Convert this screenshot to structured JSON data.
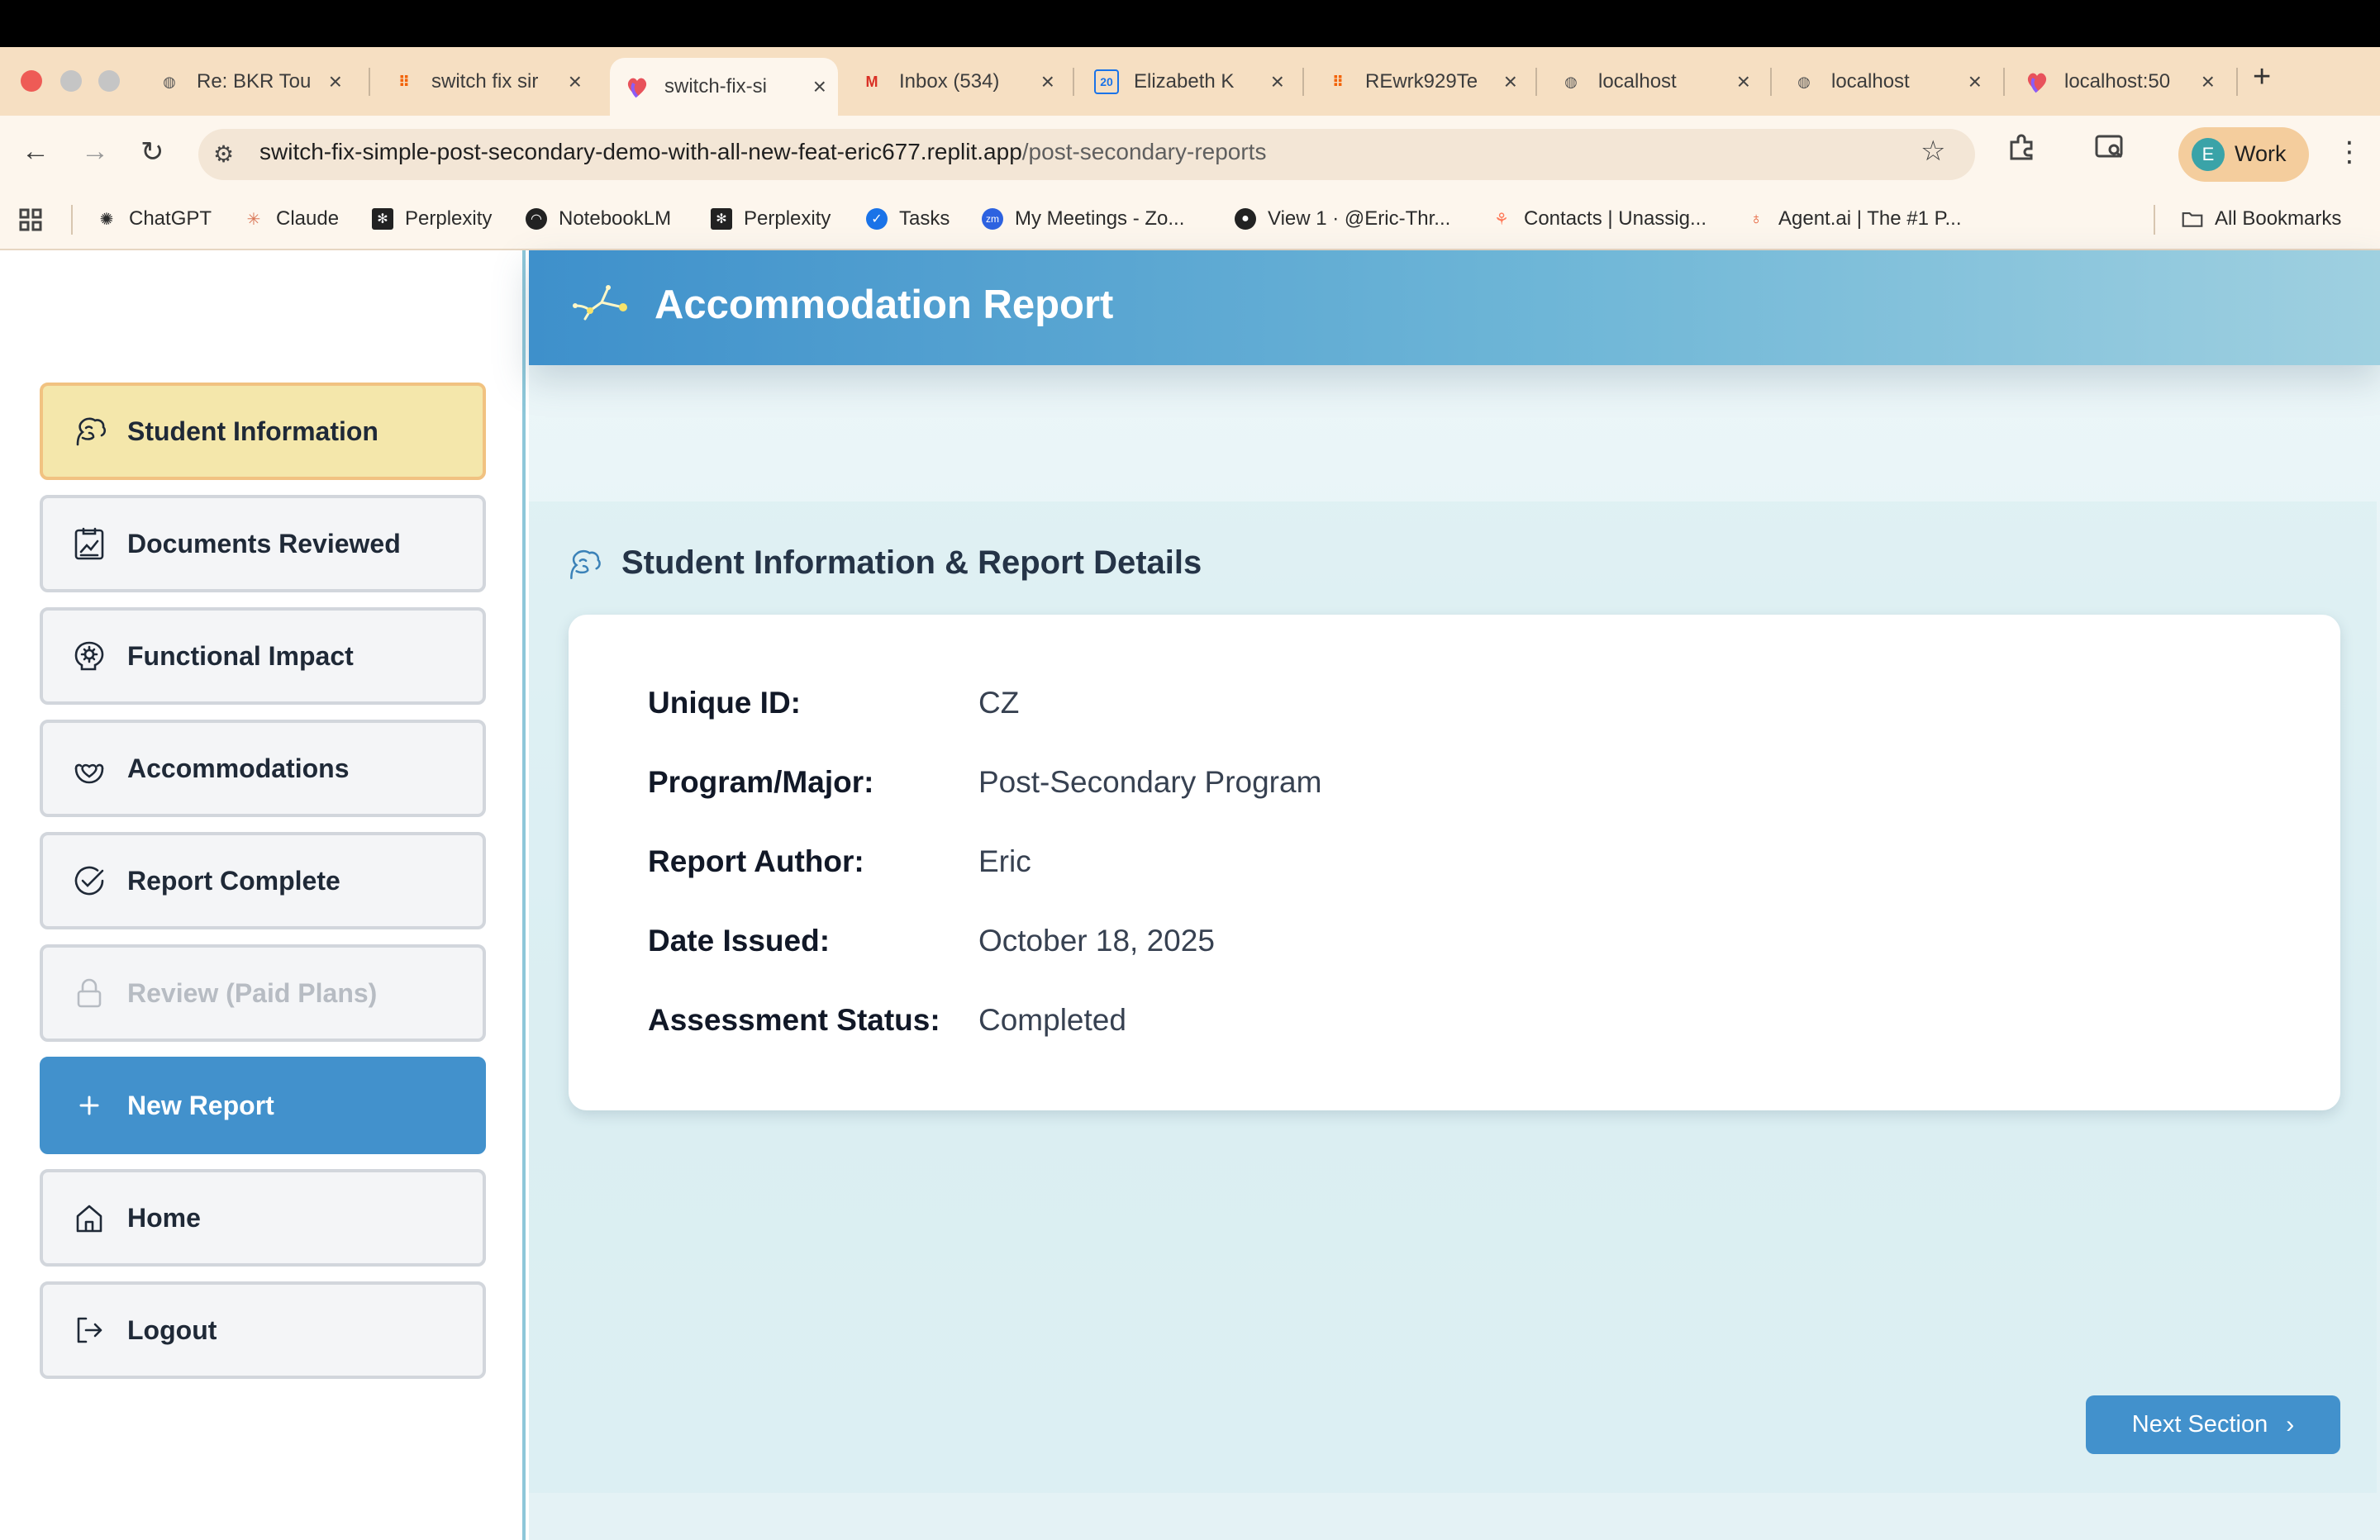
{
  "browser": {
    "tabs": [
      {
        "title": "Re: BKR Tou",
        "icon": "globe-icon"
      },
      {
        "title": "switch fix sir",
        "icon": "replit-icon"
      },
      {
        "title": "switch-fix-si",
        "icon": "app-heart-icon",
        "active": true
      },
      {
        "title": "Inbox (534)",
        "icon": "gmail-icon"
      },
      {
        "title": "Elizabeth K",
        "icon": "calendar-icon"
      },
      {
        "title": "REwrk929Te",
        "icon": "replit-icon"
      },
      {
        "title": "localhost",
        "icon": "globe-icon"
      },
      {
        "title": "localhost",
        "icon": "globe-icon"
      },
      {
        "title": "localhost:50",
        "icon": "app-heart-icon"
      }
    ],
    "new_tab": "+",
    "url_host": "switch-fix-simple-post-secondary-demo-with-all-new-feat-eric677.replit.app",
    "url_path": "/post-secondary-reports",
    "profile_initial": "E",
    "profile_label": "Work",
    "bookmarks": [
      {
        "label": "ChatGPT",
        "icon": "chatgpt-icon"
      },
      {
        "label": "Claude",
        "icon": "claude-icon"
      },
      {
        "label": "Perplexity",
        "icon": "perplexity-icon"
      },
      {
        "label": "NotebookLM",
        "icon": "notebooklm-icon"
      },
      {
        "label": "Perplexity",
        "icon": "perplexity-icon"
      },
      {
        "label": "Tasks",
        "icon": "tasks-icon"
      },
      {
        "label": "My Meetings - Zo...",
        "icon": "zoom-icon"
      },
      {
        "label": "View 1 · @Eric-Thr...",
        "icon": "github-icon"
      },
      {
        "label": "Contacts | Unassig...",
        "icon": "hubspot-icon"
      },
      {
        "label": "Agent.ai | The #1 P...",
        "icon": "agentai-icon"
      }
    ],
    "all_bookmarks": "All Bookmarks"
  },
  "colors": {
    "accent": "#4291cc",
    "active_nav_bg": "#f4e7ab",
    "active_nav_border": "#f1c281"
  },
  "header": {
    "title": "Accommodation Report"
  },
  "sidebar": {
    "items": [
      {
        "label": "Student Information",
        "icon": "student-brain-icon",
        "state": "active"
      },
      {
        "label": "Documents Reviewed",
        "icon": "document-chart-icon",
        "state": "normal"
      },
      {
        "label": "Functional Impact",
        "icon": "brain-gear-icon",
        "state": "normal"
      },
      {
        "label": "Accommodations",
        "icon": "hands-heart-icon",
        "state": "normal"
      },
      {
        "label": "Report Complete",
        "icon": "check-circle-icon",
        "state": "normal"
      },
      {
        "label": "Review (Paid Plans)",
        "icon": "lock-icon",
        "state": "disabled"
      },
      {
        "label": "New Report",
        "icon": "plus-icon",
        "state": "primary"
      },
      {
        "label": "Home",
        "icon": "home-icon",
        "state": "normal"
      },
      {
        "label": "Logout",
        "icon": "logout-icon",
        "state": "normal"
      }
    ]
  },
  "section": {
    "title": "Student Information & Report Details",
    "fields": [
      {
        "label": "Unique ID:",
        "value": "CZ"
      },
      {
        "label": "Program/Major:",
        "value": "Post-Secondary Program"
      },
      {
        "label": "Report Author:",
        "value": "Eric"
      },
      {
        "label": "Date Issued:",
        "value": "October 18, 2025"
      },
      {
        "label": "Assessment Status:",
        "value": "Completed"
      }
    ]
  },
  "footer": {
    "next_label": "Next Section"
  }
}
